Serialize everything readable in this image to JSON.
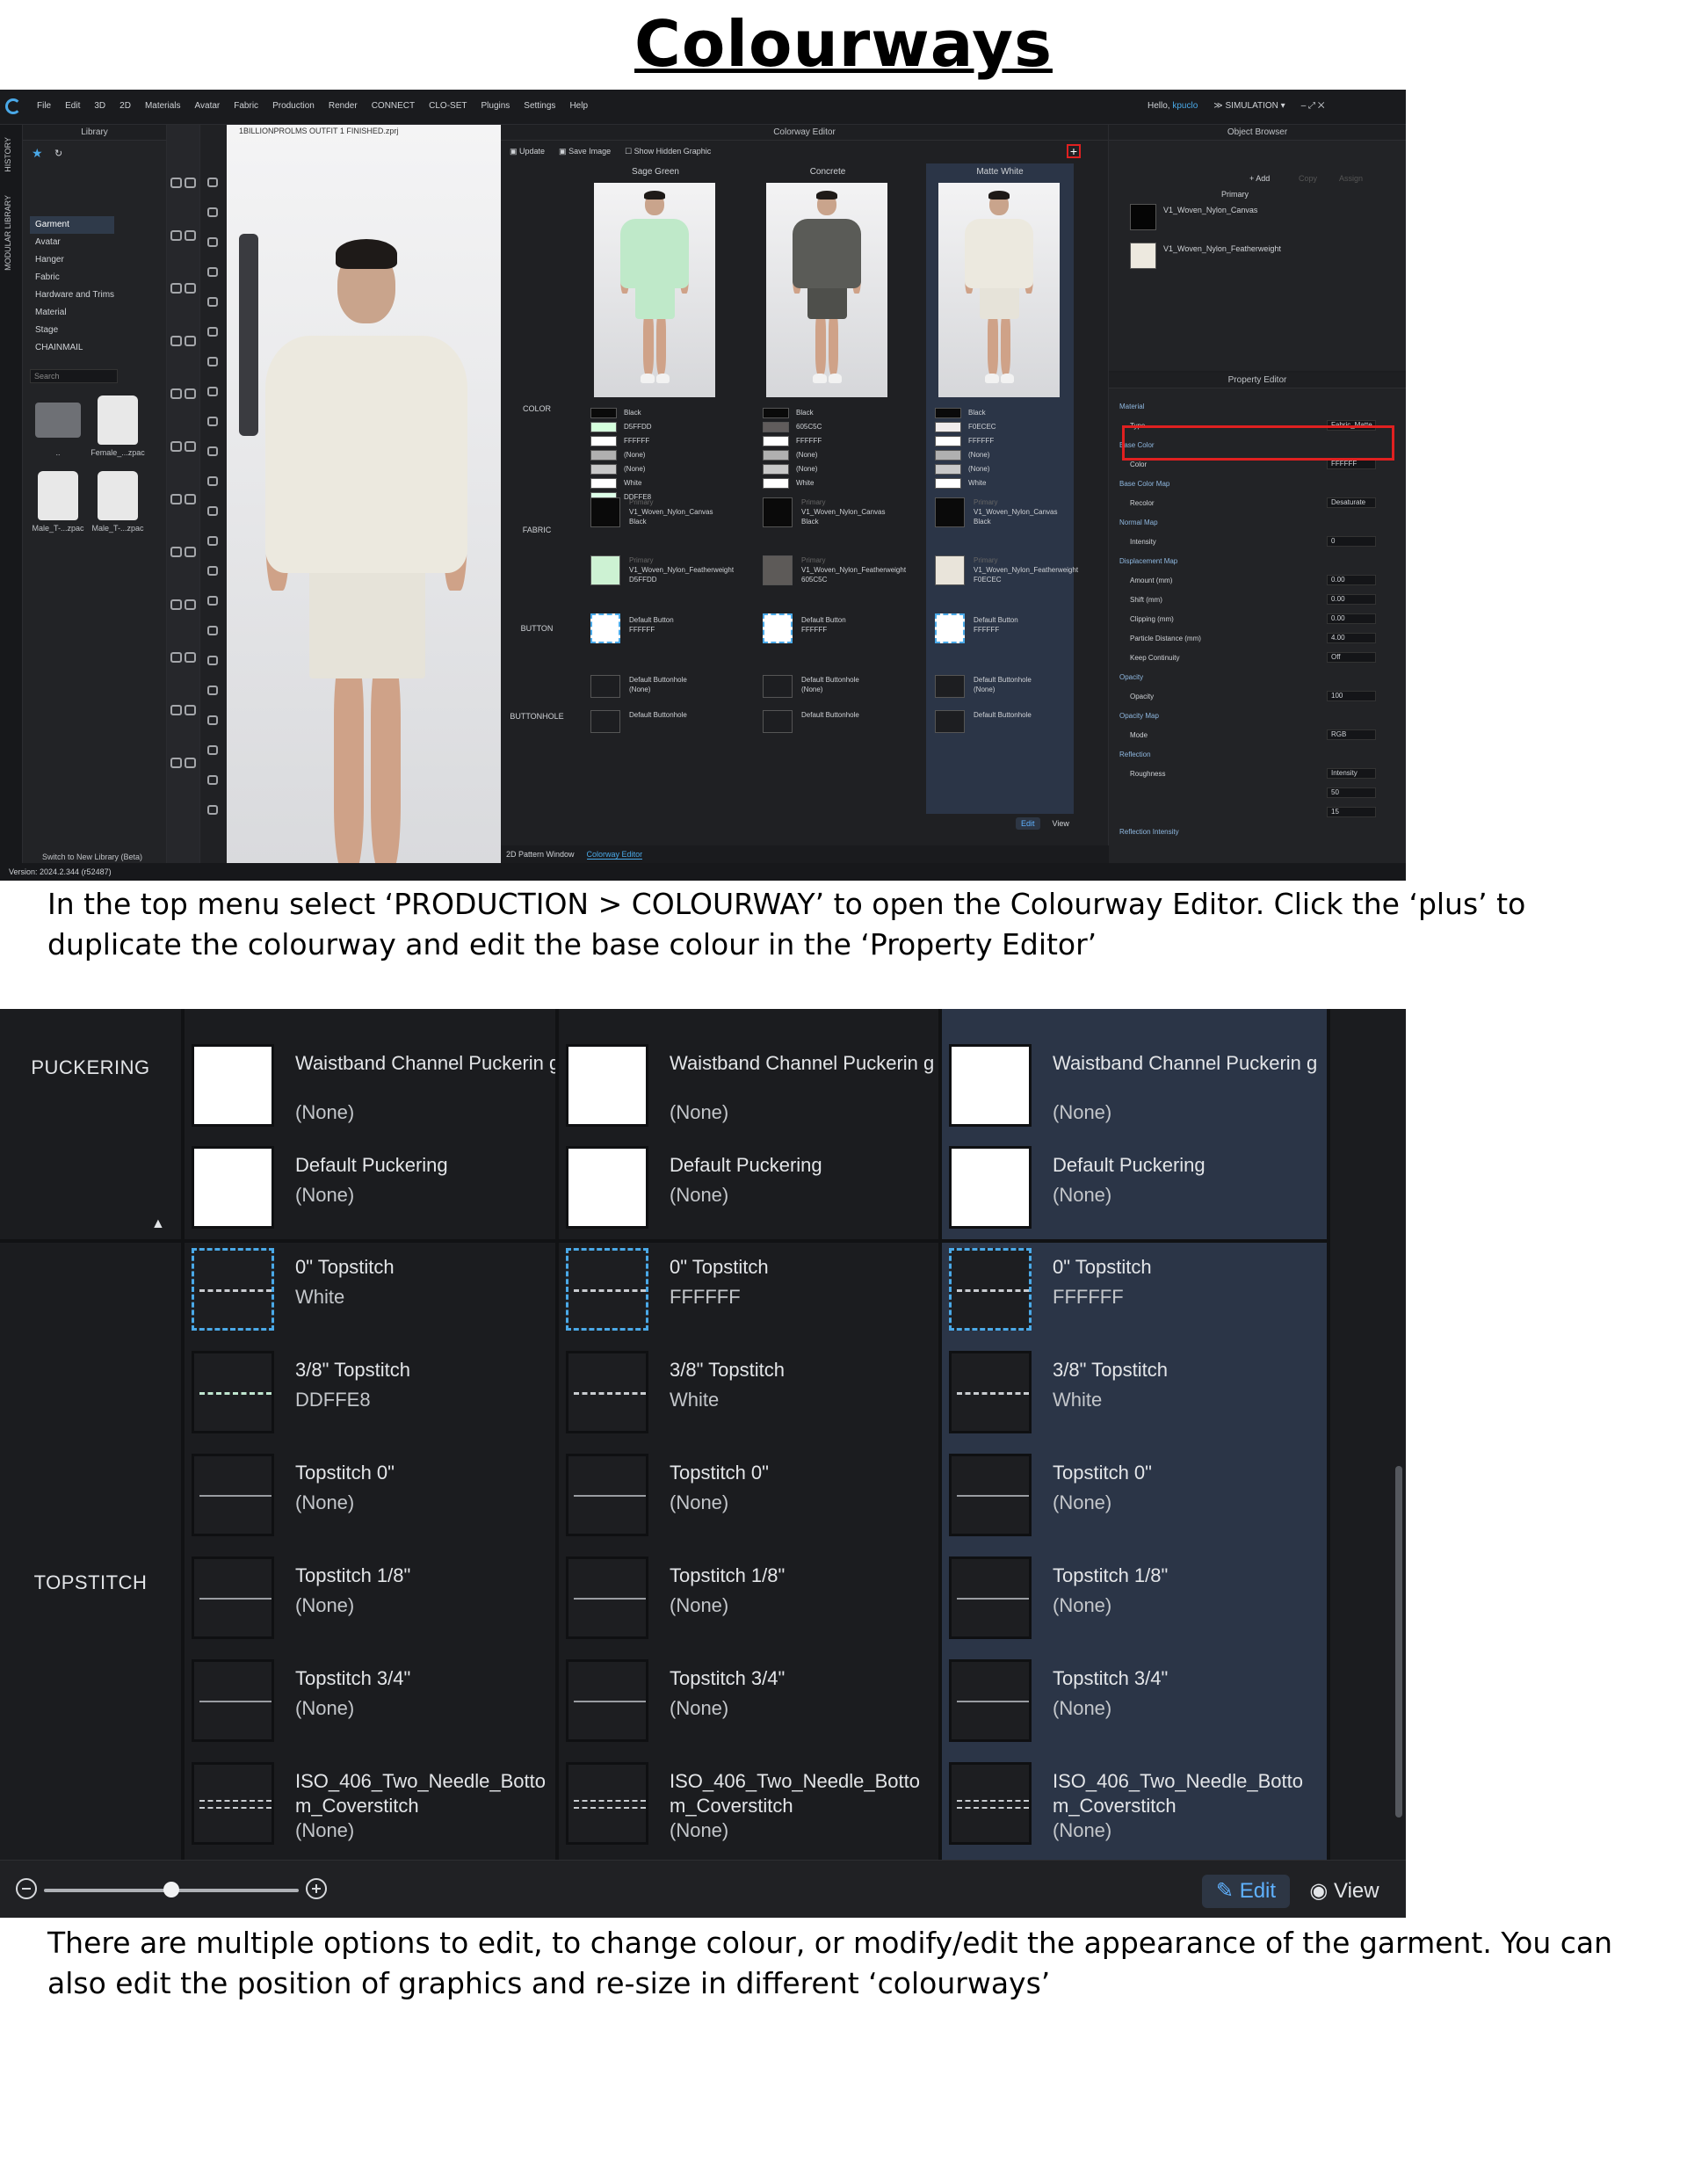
{
  "title": "Colourways",
  "caption1": "In the top menu select ‘PRODUCTION > COLOURWAY’ to open the Colourway Editor. Click the ‘plus’ to duplicate the colourway and edit the base colour in the ‘Property Editor’",
  "caption2": "There are multiple options to edit, to change colour, or modify/edit the appearance of the garment. You can also edit the position of graphics and re-size in different ‘colourways’",
  "app": {
    "menu": [
      "File",
      "Edit",
      "3D",
      "2D",
      "Materials",
      "Avatar",
      "Fabric",
      "Production",
      "Render",
      "CONNECT",
      "CLO-SET",
      "Plugins",
      "Settings",
      "Help"
    ],
    "greeting": "Hello,",
    "user": "kpuclo",
    "mode": "SIMULATION",
    "vtabs": [
      "HISTORY",
      "MODULAR LIBRARY"
    ],
    "library": {
      "title": "Library",
      "tree": [
        "Garment",
        "Avatar",
        "Hanger",
        "Fabric",
        "Hardware and Trims",
        "Material",
        "Stage",
        "CHAINMAIL"
      ],
      "search_placeholder": "Search",
      "items": [
        "..",
        "Female_...zpac",
        "Male_T-...zpac",
        "Male_T-...zpac"
      ],
      "beta_link": "Switch to New Library (Beta)"
    },
    "viewport_file": "1BILLIONPROLMS OUTFIT 1 FINISHED.zprj",
    "colorway_editor": {
      "title": "Colorway Editor",
      "toolbar": [
        "Update",
        "Save Image",
        "Show Hidden Graphic"
      ],
      "colorways": [
        {
          "name": "Sage Green",
          "shirt": "#bfe9c9",
          "shorts": "#bfe9c9",
          "colors": [
            [
              "Black",
              "#0a0a0a"
            ],
            [
              "D5FFDD",
              "#d5ffdd"
            ],
            [
              "FFFFFF",
              "#ffffff"
            ],
            [
              "(None)",
              "#b0b0b0"
            ],
            [
              "(None)",
              "#c8c8c8"
            ],
            [
              "White",
              "#ffffff"
            ],
            [
              "DDFFE8",
              "#ddffe8"
            ]
          ],
          "fabric": [
            [
              "Primary",
              "V1_Woven_Nylon_Canvas",
              "Black",
              "#0a0a0a"
            ],
            [
              "Primary",
              "V1_Woven_Nylon_Featherweight",
              "D5FFDD",
              "#cdf2d3"
            ]
          ],
          "button": [
            "Default Button",
            "FFFFFF"
          ],
          "buttonhole": [
            [
              "Default Buttonhole",
              "(None)"
            ],
            [
              "Default Buttonhole",
              ""
            ]
          ]
        },
        {
          "name": "Concrete",
          "shirt": "#5a5b57",
          "shorts": "#4e4f4b",
          "colors": [
            [
              "Black",
              "#0a0a0a"
            ],
            [
              "605C5C",
              "#605c5c"
            ],
            [
              "FFFFFF",
              "#ffffff"
            ],
            [
              "(None)",
              "#b0b0b0"
            ],
            [
              "(None)",
              "#c8c8c8"
            ],
            [
              "White",
              "#ffffff"
            ]
          ],
          "fabric": [
            [
              "Primary",
              "V1_Woven_Nylon_Canvas",
              "Black",
              "#0a0a0a"
            ],
            [
              "Primary",
              "V1_Woven_Nylon_Featherweight",
              "605C5C",
              "#5d5a58"
            ]
          ],
          "button": [
            "Default Button",
            "FFFFFF"
          ],
          "buttonhole": [
            [
              "Default Buttonhole",
              "(None)"
            ],
            [
              "Default Buttonhole",
              ""
            ]
          ]
        },
        {
          "name": "Matte White",
          "shirt": "#ece9df",
          "shorts": "#e6e3d9",
          "colors": [
            [
              "Black",
              "#0a0a0a"
            ],
            [
              "F0ECEC",
              "#f0ecec"
            ],
            [
              "FFFFFF",
              "#ffffff"
            ],
            [
              "(None)",
              "#b0b0b0"
            ],
            [
              "(None)",
              "#c8c8c8"
            ],
            [
              "White",
              "#ffffff"
            ]
          ],
          "fabric": [
            [
              "Primary",
              "V1_Woven_Nylon_Canvas",
              "Black",
              "#0a0a0a"
            ],
            [
              "Primary",
              "V1_Woven_Nylon_Featherweight",
              "F0ECEC",
              "#e9e4da"
            ]
          ],
          "button": [
            "Default Button",
            "FFFFFF"
          ],
          "buttonhole": [
            [
              "Default Buttonhole",
              "(None)"
            ],
            [
              "Default Buttonhole",
              ""
            ]
          ]
        }
      ],
      "row_labels": [
        "COLOR",
        "FABRIC",
        "BUTTON",
        "BUTTONHOLE"
      ],
      "edit": "Edit",
      "view": "View",
      "tabs": [
        "2D Pattern Window",
        "Colorway Editor"
      ]
    },
    "object_browser": {
      "title": "Object Browser",
      "add": "+ Add",
      "copy": "Copy",
      "assign": "Assign",
      "primary": "Primary",
      "fabrics": [
        [
          "V1_Woven_Nylon_Canvas",
          "#050505"
        ],
        [
          "V1_Woven_Nylon_Featherweight",
          "#ede9df"
        ]
      ]
    },
    "property_editor": {
      "title": "Property Editor",
      "rows": [
        [
          "Material",
          ""
        ],
        [
          "Type",
          "Fabric_Matte"
        ],
        [
          "Base Color",
          ""
        ],
        [
          "Color",
          "FFFFFF"
        ],
        [
          "Base Color Map",
          ""
        ],
        [
          "Recolor",
          "Desaturate"
        ],
        [
          "Normal Map",
          ""
        ],
        [
          "Intensity",
          "0"
        ],
        [
          "Displacement Map",
          ""
        ],
        [
          "Amount (mm)",
          "0.00"
        ],
        [
          "Shift (mm)",
          "0.00"
        ],
        [
          "Clipping (mm)",
          "0.00"
        ],
        [
          "Particle Distance (mm)",
          "4.00"
        ],
        [
          "Keep Continuity",
          "Off"
        ],
        [
          "Opacity",
          ""
        ],
        [
          "Opacity",
          "100"
        ],
        [
          "Opacity Map",
          ""
        ],
        [
          "Mode",
          "RGB"
        ],
        [
          "Reflection",
          ""
        ],
        [
          "Roughness",
          "Intensity"
        ],
        [
          "",
          "50"
        ],
        [
          "",
          "15"
        ],
        [
          "Reflection Intensity",
          ""
        ]
      ]
    },
    "version": "Version: 2024.2.344 (r52487)"
  },
  "zoom": {
    "row_labels": [
      "PUCKERING",
      "TOPSTITCH"
    ],
    "columns": [
      {
        "puckering": [
          [
            "Waistband Channel Puckerin g",
            "(None)"
          ],
          [
            "Default Puckering",
            "(None)"
          ]
        ],
        "topstitch": [
          [
            "0\" Topstitch",
            "White",
            "dashed",
            "#c9ccd0"
          ],
          [
            "3/8\" Topstitch",
            "DDFFE8",
            "stitch",
            "#bfe6cf"
          ],
          [
            "Topstitch 0\"",
            "(None)",
            "thin",
            "#9a9da2"
          ],
          [
            "Topstitch 1/8\"",
            "(None)",
            "thin",
            "#9a9da2"
          ],
          [
            "Topstitch 3/4\"",
            "(None)",
            "thin",
            "#9a9da2"
          ],
          [
            "ISO_406_Two_Needle_Botto m_Coverstitch",
            "(None)",
            "double",
            "#c9ccd0"
          ]
        ]
      },
      {
        "puckering": [
          [
            "Waistband Channel Puckerin g",
            "(None)"
          ],
          [
            "Default Puckering",
            "(None)"
          ]
        ],
        "topstitch": [
          [
            "0\" Topstitch",
            "FFFFFF",
            "dashed",
            "#c9ccd0"
          ],
          [
            "3/8\" Topstitch",
            "White",
            "stitch",
            "#c9ccd0"
          ],
          [
            "Topstitch 0\"",
            "(None)",
            "thin",
            "#9a9da2"
          ],
          [
            "Topstitch 1/8\"",
            "(None)",
            "thin",
            "#9a9da2"
          ],
          [
            "Topstitch 3/4\"",
            "(None)",
            "thin",
            "#9a9da2"
          ],
          [
            "ISO_406_Two_Needle_Botto m_Coverstitch",
            "(None)",
            "double",
            "#c9ccd0"
          ]
        ]
      },
      {
        "puckering": [
          [
            "Waistband Channel Puckerin g",
            "(None)"
          ],
          [
            "Default Puckering",
            "(None)"
          ]
        ],
        "topstitch": [
          [
            "0\" Topstitch",
            "FFFFFF",
            "dashed",
            "#c9ccd0"
          ],
          [
            "3/8\" Topstitch",
            "White",
            "stitch",
            "#c9ccd0"
          ],
          [
            "Topstitch 0\"",
            "(None)",
            "thin",
            "#9a9da2"
          ],
          [
            "Topstitch 1/8\"",
            "(None)",
            "thin",
            "#9a9da2"
          ],
          [
            "Topstitch 3/4\"",
            "(None)",
            "thin",
            "#9a9da2"
          ],
          [
            "ISO_406_Two_Needle_Botto m_Coverstitch",
            "(None)",
            "double",
            "#c9ccd0"
          ]
        ]
      }
    ],
    "edit": "Edit",
    "view": "View"
  }
}
